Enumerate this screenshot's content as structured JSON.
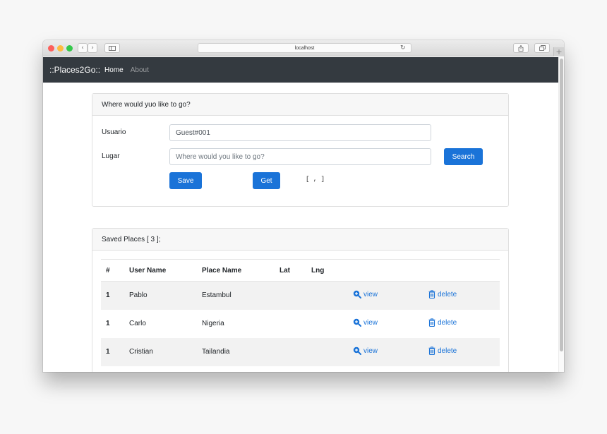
{
  "browser": {
    "address": "localhost",
    "traffic_lights": [
      "#fc605c",
      "#fdbc40",
      "#34c84a"
    ],
    "back_icon": "chevron-left-icon",
    "forward_icon": "chevron-right-icon",
    "sidebar_icon": "sidebar-icon",
    "reload_icon": "reload-icon",
    "share_icon": "share-icon",
    "tabs_icon": "tabs-icon",
    "new_tab_icon": "plus-icon"
  },
  "navbar": {
    "brand": "::Places2Go::",
    "links": [
      "Home",
      "About"
    ]
  },
  "form_card": {
    "header": "Where would yuo like to go?",
    "usuario_label": "Usuario",
    "usuario_value": "Guest#001",
    "lugar_label": "Lugar",
    "lugar_placeholder": "Where would you like to go?",
    "search_label": "Search",
    "save_label": "Save",
    "get_label": "Get",
    "coords": "[ , ]"
  },
  "saved_card": {
    "header": "Saved Places [ 3 ];",
    "columns": [
      "#",
      "User Name",
      "Place Name",
      "Lat",
      "Lng"
    ],
    "rows": [
      {
        "num": "1",
        "user": "Pablo",
        "place": "Estambul",
        "lat": "",
        "lng": "",
        "view": "view",
        "delete": "delete"
      },
      {
        "num": "1",
        "user": "Carlo",
        "place": "Nigeria",
        "lat": "",
        "lng": "",
        "view": "view",
        "delete": "delete"
      },
      {
        "num": "1",
        "user": "Cristian",
        "place": "Tailandia",
        "lat": "",
        "lng": "",
        "view": "view",
        "delete": "delete"
      }
    ]
  },
  "colors": {
    "primary": "#1a73d8",
    "navbar": "#343a40"
  }
}
